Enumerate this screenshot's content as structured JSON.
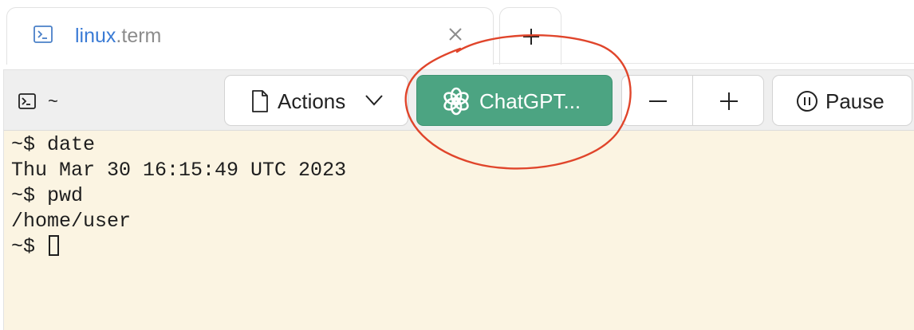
{
  "tab": {
    "name": "linux",
    "ext": ".term",
    "icon": "terminal-icon"
  },
  "toolbar": {
    "path": "~",
    "path_icon": "terminal-icon",
    "actions_label": "Actions",
    "chatgpt_label": "ChatGPT...",
    "pause_label": "Pause"
  },
  "terminal": {
    "lines": [
      "~$ date",
      "Thu Mar 30 16:15:49 UTC 2023",
      "~$ pwd",
      "/home/user"
    ],
    "prompt": "~$ "
  },
  "colors": {
    "accent": "#3a7bd5",
    "chatgpt_button": "#4ca482",
    "terminal_bg": "#fbf4e2",
    "annotation": "#e0452b"
  }
}
